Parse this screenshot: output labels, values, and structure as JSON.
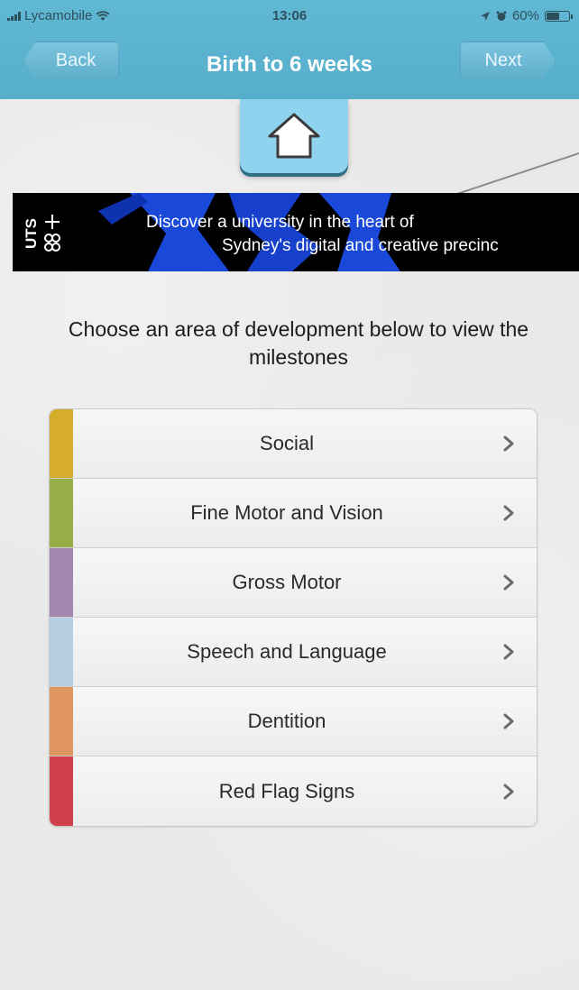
{
  "status_bar": {
    "carrier": "Lycamobile",
    "time": "13:06",
    "battery": "60%",
    "battery_level": 0.6,
    "icons": [
      "signal-icon",
      "wifi-icon",
      "location-arrow-icon",
      "alarm-icon",
      "battery-icon"
    ]
  },
  "nav": {
    "back_label": "Back",
    "title": "Birth to 6 weeks",
    "next_label": "Next"
  },
  "home": {
    "icon": "home-icon"
  },
  "ad": {
    "line1": "Discover a university in the heart of",
    "line2": "Sydney's digital and creative precinc",
    "logo_text": "UTS"
  },
  "instructions": "Choose an area of development below to view the milestones",
  "categories": [
    {
      "label": "Social",
      "color": "#d5ad2b"
    },
    {
      "label": "Fine Motor and Vision",
      "color": "#97ad45"
    },
    {
      "label": "Gross Motor",
      "color": "#a187ad"
    },
    {
      "label": "Speech and Language",
      "color": "#b5cfe0"
    },
    {
      "label": "Dentition",
      "color": "#e0975f"
    },
    {
      "label": "Red Flag Signs",
      "color": "#d2404b"
    }
  ],
  "colors": {
    "nav_bar": "#5bb3cf",
    "home_button": "#8fd3ef",
    "background": "#e9e9e9"
  }
}
